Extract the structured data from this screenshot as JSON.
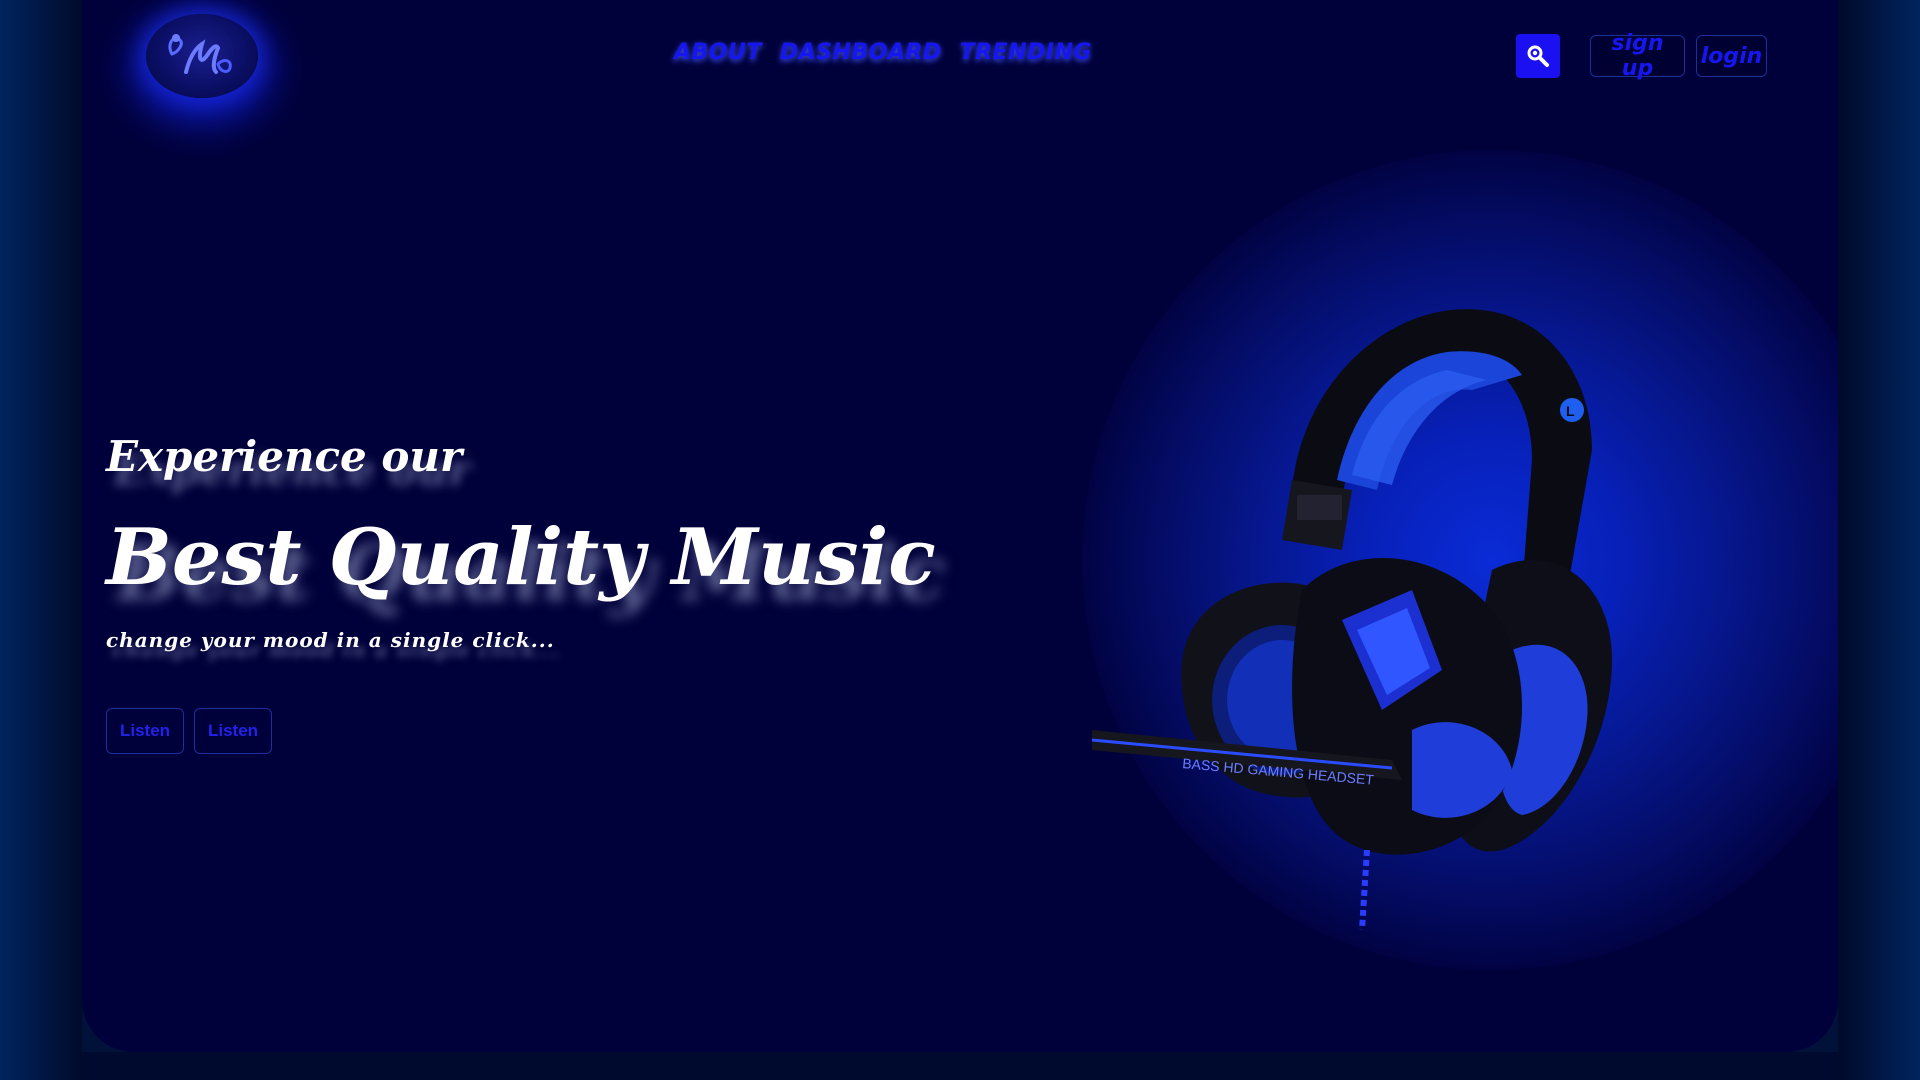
{
  "brand": {
    "logo_icon": "music-note-logo-icon"
  },
  "nav": {
    "items": [
      {
        "label": "ABOUT"
      },
      {
        "label": "DASHBOARD"
      },
      {
        "label": "TRENDING"
      }
    ]
  },
  "header": {
    "search_icon": "search-icon",
    "signup_label": "sign up",
    "login_label": "login"
  },
  "hero": {
    "subtitle": "Experience our",
    "title": "Best Quality Music",
    "tagline": "change your mood in a single click...",
    "buttons": [
      {
        "label": "Listen"
      },
      {
        "label": "Listen"
      }
    ],
    "image_caption": "BASS HD GAMING HEADSET",
    "image_marker": "L"
  },
  "colors": {
    "panel_bg": "#00003a",
    "accent_blue": "#1a10f2",
    "nav_text": "#1616f0",
    "glow": "#0a2bd6",
    "hero_text": "#ffffff"
  }
}
